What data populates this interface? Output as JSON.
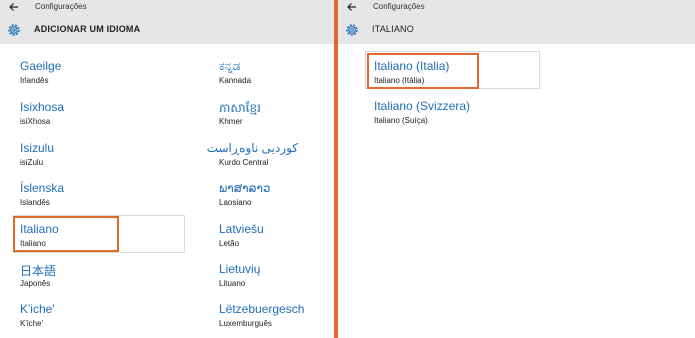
{
  "left": {
    "title": "Configurações",
    "header": "ADICIONAR UM IDIOMA",
    "column1": [
      {
        "native": "Gaeilge",
        "local": "Irlandês"
      },
      {
        "native": "Isixhosa",
        "local": "isiXhosa"
      },
      {
        "native": "Isizulu",
        "local": "isiZulu"
      },
      {
        "native": "Íslenska",
        "local": "Islandês"
      },
      {
        "native": "Italiano",
        "local": "Italiano"
      },
      {
        "native": "日本語",
        "local": "Japonês"
      },
      {
        "native": "K'iche'",
        "local": "K'iche'"
      }
    ],
    "column2": [
      {
        "native": "ಕನ್ನಡ",
        "local": "Kannada"
      },
      {
        "native": "ភាសាខ្មែរ",
        "local": "Khmer"
      },
      {
        "native": "کوردیی ناوەڕاست",
        "local": "Kurdo Central"
      },
      {
        "native": "ພາສາລາວ",
        "local": "Laosiano"
      },
      {
        "native": "Latviešu",
        "local": "Letão"
      },
      {
        "native": "Lietuvių",
        "local": "Lituano"
      },
      {
        "native": "Lëtzebuergesch",
        "local": "Luxemburguês"
      }
    ]
  },
  "right": {
    "title": "Configurações",
    "header": "ITALIANO",
    "items": [
      {
        "native": "Italiano (Italia)",
        "local": "Italiano (Itália)"
      },
      {
        "native": "Italiano (Svizzera)",
        "local": "Italiano (Suíça)"
      }
    ]
  },
  "colors": {
    "accent_link": "#1f6fb8",
    "highlight": "#e26a2c",
    "header_bg": "#e6e6e6"
  },
  "icons": {
    "back": "back-arrow-icon",
    "settings": "gear-icon"
  }
}
